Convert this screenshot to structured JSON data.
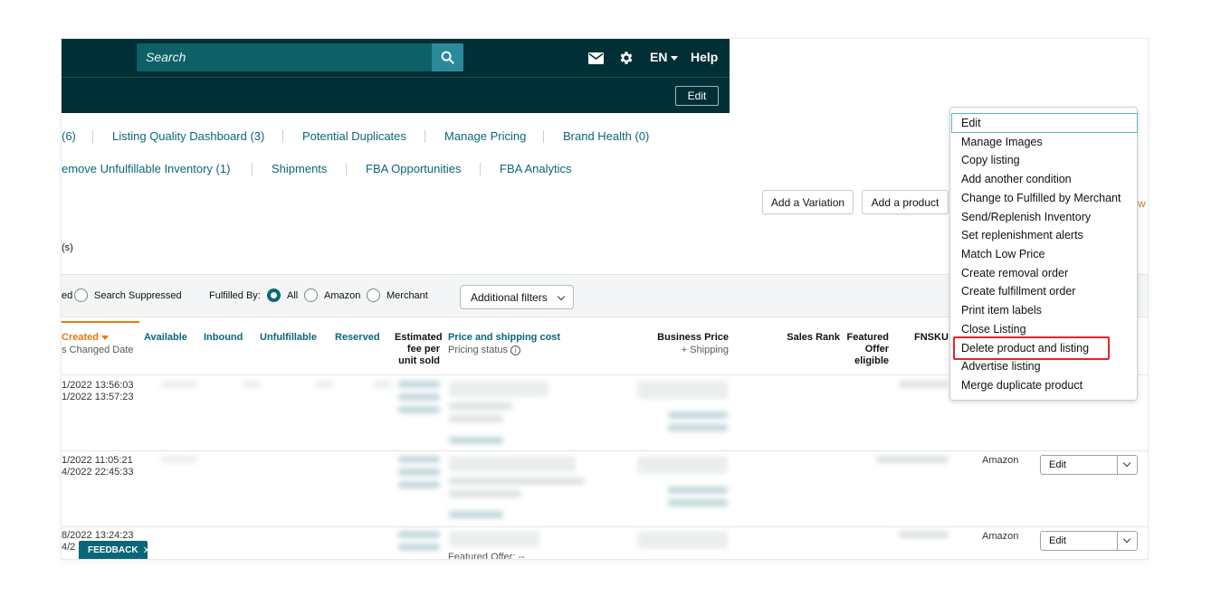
{
  "header": {
    "search_placeholder": "Search",
    "icons": [
      "search-icon",
      "mail-icon",
      "gear-icon"
    ],
    "language": "EN",
    "help": "Help",
    "sub_edit": "Edit"
  },
  "tabs_row1": [
    "(6)",
    "Listing Quality Dashboard (3)",
    "Potential Duplicates",
    "Manage Pricing",
    "Brand Health (0)"
  ],
  "tabs_row2": [
    "emove Unfulfillable Inventory (1)",
    "Shipments",
    "FBA Opportunities",
    "FBA Analytics"
  ],
  "actions": {
    "add_variation": "Add a Variation",
    "add_product": "Add a product"
  },
  "result_count_fragment": "(s)",
  "filters": {
    "status_fragment": "ed",
    "search_suppressed": "Search Suppressed",
    "fulfilled_by_label": "Fulfilled By:",
    "all": "All",
    "amazon": "Amazon",
    "merchant": "Merchant",
    "selected": "All",
    "additional_filters": "Additional filters"
  },
  "table": {
    "headers": {
      "created": "Created",
      "changed": "s Changed Date",
      "available": "Available",
      "inbound": "Inbound",
      "unfulfillable": "Unfulfillable",
      "reserved": "Reserved",
      "fee": [
        "Estimated",
        "fee per",
        "unit sold"
      ],
      "price": "Price and shipping cost",
      "pricing_status": "Pricing status",
      "business_price": "Business Price",
      "plus_shipping": "+ Shipping",
      "sales_rank": "Sales Rank",
      "featured": [
        "Featured",
        "Offer",
        "eligible"
      ],
      "fnsku": "FNSKU"
    },
    "rows": [
      {
        "created": "1/2022 13:56:03",
        "changed": "1/2022 13:57:23",
        "fulfilled": "",
        "edit": ""
      },
      {
        "created": "1/2022 11:05:21",
        "changed": "4/2022 22:45:33",
        "fulfilled": "Amazon",
        "edit": "Edit"
      },
      {
        "created": "8/2022 13:24:23",
        "changed": "4/2",
        "fulfilled": "Amazon",
        "edit": "Edit"
      }
    ],
    "partial_text": "Featured Offer: --"
  },
  "feedback": "FEEDBACK",
  "menu": {
    "items": [
      "Edit",
      "Manage Images",
      "Copy listing",
      "Add another condition",
      "Change to Fulfilled by Merchant",
      "Send/Replenish Inventory",
      "Set replenishment alerts",
      "Match Low Price",
      "Create removal order",
      "Create fulfillment order",
      "Print item labels",
      "Close Listing",
      "Delete product and listing",
      "Advertise listing",
      "Merge duplicate product"
    ],
    "highlighted": "Delete product and listing",
    "highlight_color": "#e3242b"
  },
  "colors": {
    "header_bg": "#002f36",
    "link": "#0a6678",
    "accent_orange": "#e47911"
  }
}
